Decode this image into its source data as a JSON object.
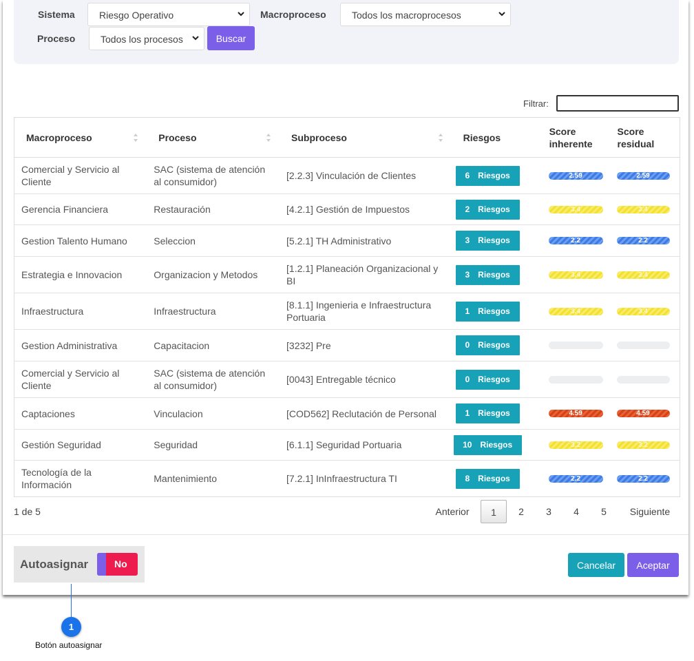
{
  "filters": {
    "sistema_label": "Sistema",
    "sistema_value": "Riesgo Operativo",
    "macroproceso_label": "Macroproceso",
    "macroproceso_value": "Todos los macroprocesos",
    "proceso_label": "Proceso",
    "proceso_value": "Todos los procesos",
    "buscar_label": "Buscar"
  },
  "filtrar_label": "Filtrar:",
  "table": {
    "headers": {
      "macroproceso": "Macroproceso",
      "proceso": "Proceso",
      "subproceso": "Subproceso",
      "riesgos": "Riesgos",
      "score_inherente": "Score inherente",
      "score_residual": "Score residual"
    },
    "riesgos_word": "Riesgos",
    "rows": [
      {
        "macro": "Comercial y Servicio al Cliente",
        "proceso": "SAC (sistema de atención al consumidor)",
        "sub": "[2.2.3] Vinculación de Clientes",
        "riesgos": "6",
        "inh": "2.59",
        "res": "2.59",
        "color": "blue"
      },
      {
        "macro": "Gerencia Financiera",
        "proceso": "Restauración",
        "sub": "[4.2.1] Gestión de Impuestos",
        "riesgos": "2",
        "inh": "3.4",
        "res": "3.4",
        "color": "yellow"
      },
      {
        "macro": "Gestion Talento Humano",
        "proceso": "Seleccion",
        "sub": "[5.2.1] TH Administrativo",
        "riesgos": "3",
        "inh": "2.2",
        "res": "2.2",
        "color": "blue"
      },
      {
        "macro": "Estrategia e Innovacion",
        "proceso": "Organizacion y Metodos",
        "sub": "[1.2.1] Planeación Organizacional y BI",
        "riesgos": "3",
        "inh": "3.4",
        "res": "3.4",
        "color": "yellow"
      },
      {
        "macro": "Infraestructura",
        "proceso": "Infraestructura",
        "sub": "[8.1.1] Ingenieria e Infraestructura Portuaria",
        "riesgos": "1",
        "inh": "3.4",
        "res": "3.4",
        "color": "yellow"
      },
      {
        "macro": "Gestion Administrativa",
        "proceso": "Capacitacion",
        "sub": "[3232] Pre",
        "riesgos": "0",
        "inh": "",
        "res": "",
        "color": "empty"
      },
      {
        "macro": "Comercial y Servicio al Cliente",
        "proceso": "SAC (sistema de atención al consumidor)",
        "sub": "[0043] Entregable técnico",
        "riesgos": "0",
        "inh": "",
        "res": "",
        "color": "empty"
      },
      {
        "macro": "Captaciones",
        "proceso": "Vinculacion",
        "sub": "[COD562] Reclutación de Personal",
        "riesgos": "1",
        "inh": "4.59",
        "res": "4.59",
        "color": "red"
      },
      {
        "macro": "Gestión Seguridad",
        "proceso": "Seguridad",
        "sub": "[6.1.1] Seguridad Portuaria",
        "riesgos": "10",
        "inh": "3.2",
        "res": "3.2",
        "color": "yellow"
      },
      {
        "macro": "Tecnología de la Información",
        "proceso": "Mantenimiento",
        "sub": "[7.2.1] InInfraestructura TI",
        "riesgos": "8",
        "inh": "2.2",
        "res": "2.2",
        "color": "blue"
      }
    ]
  },
  "pagination": {
    "info": "1 de 5",
    "prev": "Anterior",
    "pages": [
      "1",
      "2",
      "3",
      "4",
      "5"
    ],
    "next": "Siguiente",
    "current": "1"
  },
  "footer": {
    "autoasignar_label": "Autoasignar",
    "toggle_value": "No",
    "cancel_label": "Cancelar",
    "accept_label": "Aceptar"
  },
  "callout": {
    "number": "1",
    "label": "Botón autoasignar"
  },
  "colors": {
    "primary": "#7b5fe8",
    "info": "#17a2b8",
    "toggle_off": "#ee1c4e",
    "callout": "#1a73e8"
  }
}
